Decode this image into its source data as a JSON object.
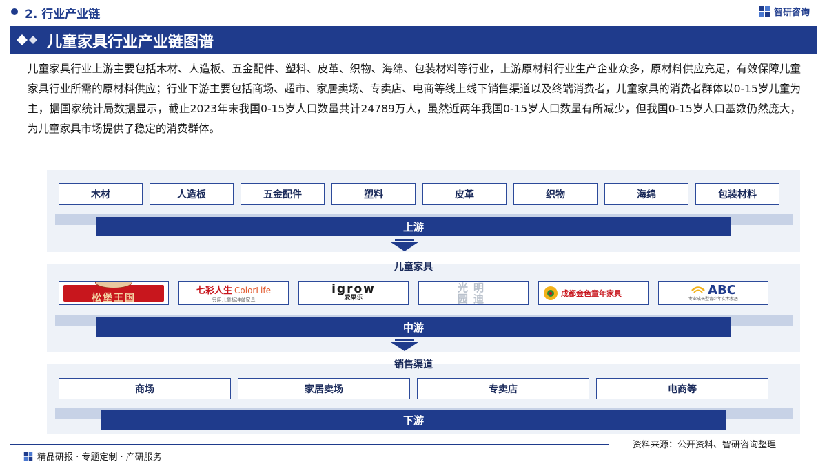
{
  "header": {
    "section_label": "2. 行业产业链",
    "brand": "智研咨询"
  },
  "title": "儿童家具行业产业链图谱",
  "paragraph": "儿童家具行业上游主要包括木材、人造板、五金配件、塑料、皮革、织物、海绵、包装材料等行业，上游原材料行业生产企业众多，原材料供应充足，有效保障儿童家具行业所需的原材料供应；行业下游主要包括商场、超市、家居卖场、专卖店、电商等线上线下销售渠道以及终端消费者，儿童家具的消费者群体以0-15岁儿童为主，据国家统计局数据显示，截止2023年末我国0-15岁人口数量共计24789万人，虽然近两年我国0-15岁人口数量有所减少，但我国0-15岁人口基数仍然庞大，为儿童家具市场提供了稳定的消费群体。",
  "diagram": {
    "upstream": {
      "items": [
        "木材",
        "人造板",
        "五金配件",
        "塑料",
        "皮革",
        "织物",
        "海绵",
        "包装材料"
      ],
      "label": "上游"
    },
    "midstream": {
      "title": "儿童家具",
      "label": "中游",
      "logos": [
        {
          "name": "松堡王国",
          "text": "松堡王国",
          "color": "#c8161d"
        },
        {
          "name": "七彩人生",
          "text": "七彩人生",
          "text2": "ColorLife",
          "sub": "只用儿童标准做家具",
          "color": "#c8161d"
        },
        {
          "name": "igrow爱果乐",
          "text": "igrow",
          "sub": "爱果乐",
          "color": "#1a1a1a"
        },
        {
          "name": "光明园迪",
          "text": "光明",
          "sub": "园迪",
          "color": "#c9cfd8"
        },
        {
          "name": "成都金色童年家具",
          "text": "成都金色童年家具",
          "color": "#c8161d"
        },
        {
          "name": "ABC",
          "text": "ABC",
          "sub": "专业成长型青少年实木家居",
          "color": "#1f3b8c"
        }
      ]
    },
    "downstream": {
      "title": "销售渠道",
      "label": "下游",
      "items": [
        "商场",
        "家居卖场",
        "专卖店",
        "电商等"
      ]
    }
  },
  "footer": {
    "left": "精品研报 · 专题定制 · 产研服务",
    "source": "资料来源：公开资料、智研咨询整理"
  }
}
